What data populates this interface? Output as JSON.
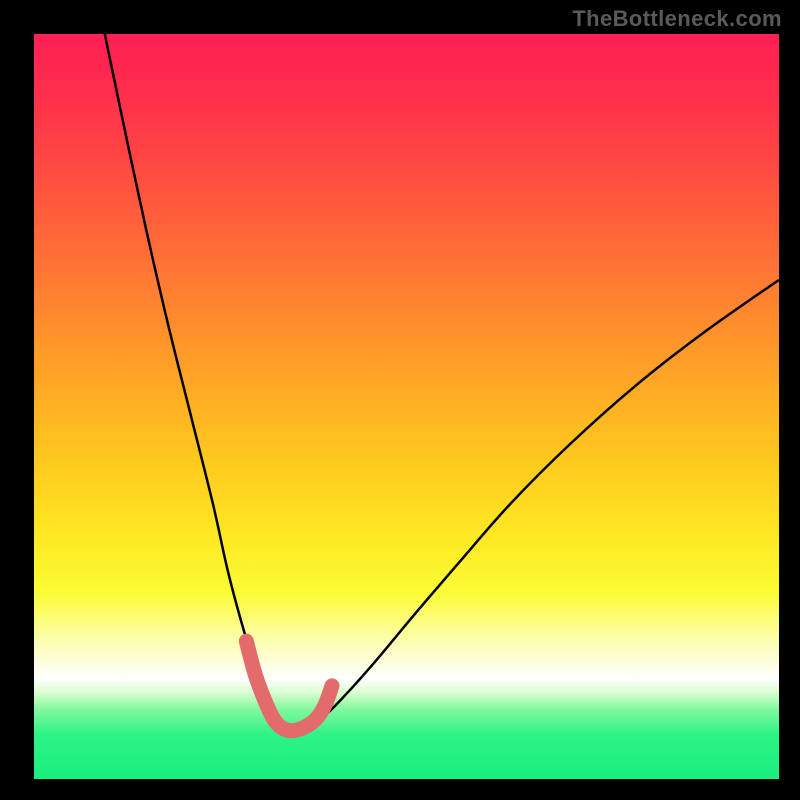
{
  "watermark": "TheBottleneck.com",
  "chart_data": {
    "type": "line",
    "title": "",
    "xlabel": "",
    "ylabel": "",
    "xlim": [
      0,
      100
    ],
    "ylim": [
      0,
      100
    ],
    "series": [
      {
        "name": "bottleneck-curve",
        "x": [
          9.5,
          12,
          15,
          18,
          21,
          24,
          26,
          28,
          30,
          31.5,
          33,
          34.5,
          36.5,
          39,
          42,
          46,
          51,
          57,
          64,
          72,
          81,
          90,
          100
        ],
        "y": [
          100,
          88,
          74,
          61,
          49,
          37,
          28,
          20.5,
          14,
          10,
          7.5,
          6.5,
          7.0,
          8.5,
          11.5,
          16,
          22,
          29,
          37,
          45,
          53,
          60,
          67
        ]
      },
      {
        "name": "highlight-markers",
        "x": [
          28.5,
          29.7,
          31.0,
          32.2,
          33.4,
          34.8,
          36.4,
          37.8,
          39.0,
          40.0
        ],
        "y": [
          18.5,
          14.0,
          10.5,
          8.0,
          6.8,
          6.5,
          7.0,
          8.0,
          9.8,
          12.5
        ]
      }
    ]
  }
}
